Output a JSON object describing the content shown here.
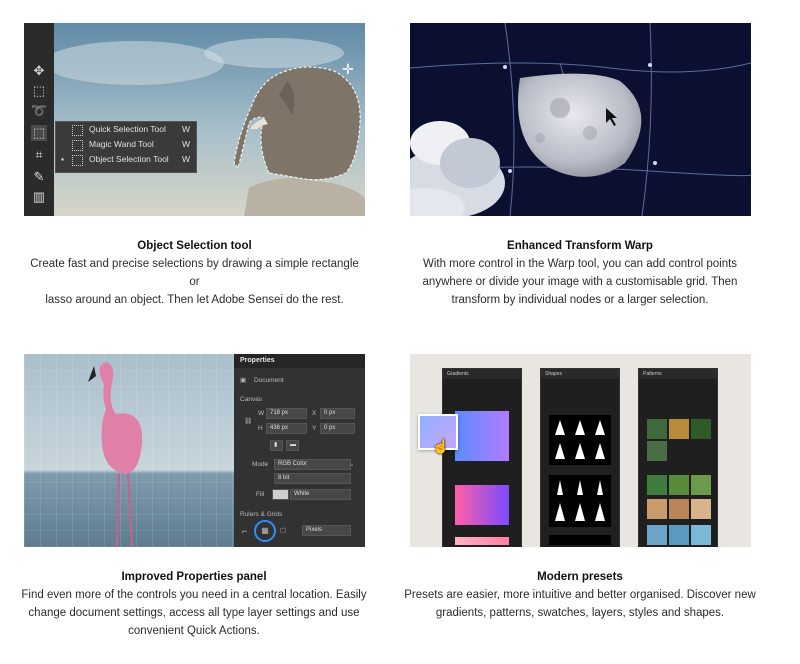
{
  "features": [
    {
      "title": "Object Selection tool",
      "description_lines": [
        "Create fast and precise selections by drawing a simple rectangle or",
        "lasso around an object. Then let Adobe Sensei do the rest."
      ],
      "flyout": [
        {
          "label": "Quick Selection Tool",
          "shortcut": "W"
        },
        {
          "label": "Magic Wand Tool",
          "shortcut": "W"
        },
        {
          "label": "Object Selection Tool",
          "shortcut": "W"
        }
      ]
    },
    {
      "title": "Enhanced Transform Warp",
      "description_lines": [
        "With more control in the Warp tool, you can add control points",
        "anywhere or divide your image with a customisable grid. Then",
        "transform by individual nodes or a larger selection."
      ]
    },
    {
      "title": "Improved Properties panel",
      "description_lines": [
        "Find even more of the controls you need in a central location. Easily",
        "change document settings, access all type layer settings and use",
        "convenient Quick Actions."
      ],
      "panel": {
        "header": "Properties",
        "doc_label": "Document",
        "canvas_label": "Canvas",
        "w_label": "W",
        "w_value": "718 px",
        "h_label": "H",
        "h_value": "436 px",
        "x_label": "X",
        "x_value": "0 px",
        "y_label": "Y",
        "y_value": "0 px",
        "mode_label": "Mode",
        "mode_value": "RGB Color",
        "bits_value": "8 bit",
        "fill_label": "Fill",
        "fill_value": "White",
        "rulers_label": "Rulers & Grids",
        "units_value": "Pixels"
      }
    },
    {
      "title": "Modern presets",
      "description_lines": [
        "Presets are easier, more intuitive and better organised. Discover new",
        "gradients, patterns, swatches, layers, styles and shapes."
      ],
      "panels": [
        "Gradients",
        "Shapes",
        "Patterns"
      ]
    }
  ]
}
